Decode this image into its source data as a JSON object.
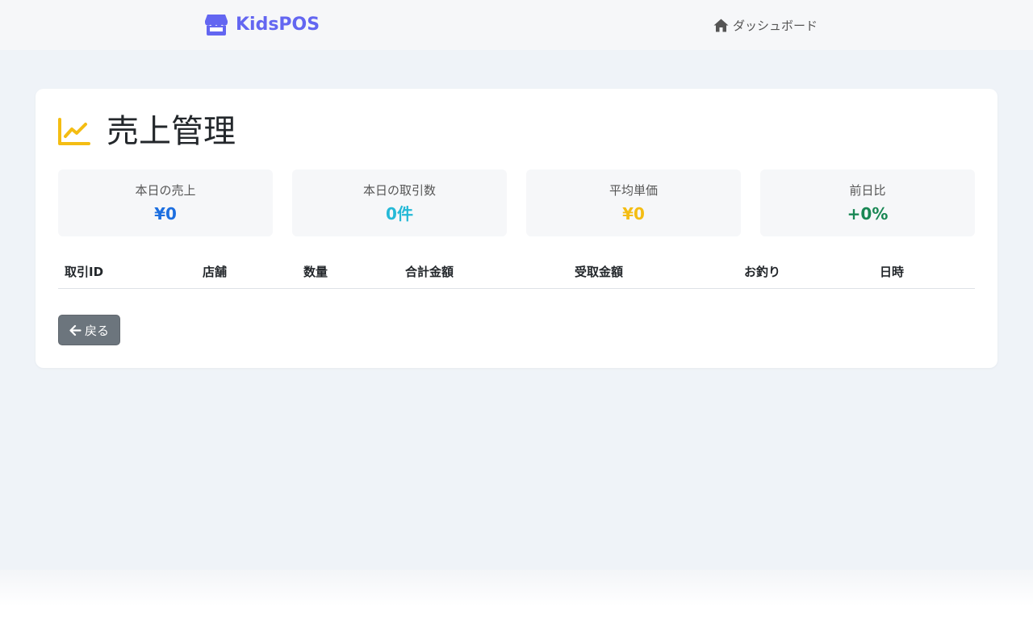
{
  "navbar": {
    "brand": "KidsPOS",
    "brand_icon": "store-icon",
    "dashboard_link": "ダッシュボード",
    "dashboard_icon": "home-icon"
  },
  "page": {
    "title": "売上管理",
    "title_icon": "chart-line-icon"
  },
  "stats": [
    {
      "label": "本日の売上",
      "value": "¥0",
      "color": "#1d6fe0"
    },
    {
      "label": "本日の取引数",
      "value": "0件",
      "color": "#25b9d7"
    },
    {
      "label": "平均単価",
      "value": "¥0",
      "color": "#f4bd13"
    },
    {
      "label": "前日比",
      "value": "+0%",
      "color": "#198754"
    }
  ],
  "table": {
    "headers": [
      "取引ID",
      "店舗",
      "数量",
      "合計金額",
      "受取金額",
      "お釣り",
      "日時"
    ],
    "rows": []
  },
  "actions": {
    "back_label": "戻る",
    "back_icon": "arrow-left-icon"
  },
  "colors": {
    "brand": "#6366f1",
    "title_icon": "#f4bd13",
    "secondary_button": "#6c757d"
  }
}
